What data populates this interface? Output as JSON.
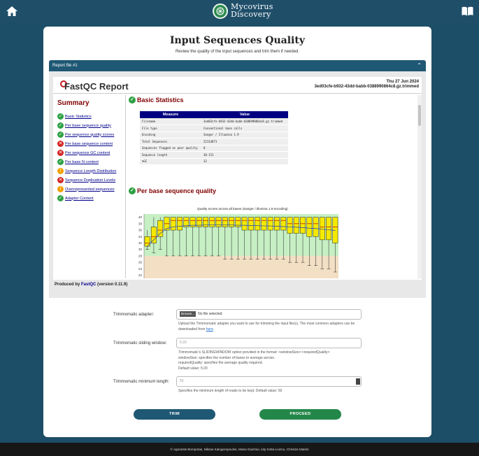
{
  "app": {
    "name_line1": "Mycovirus",
    "name_line2": "Discovery"
  },
  "page": {
    "title": "Input Sequences Quality",
    "subtitle": "Review the quality of the input sequences and trim them if needed."
  },
  "report": {
    "header": "Report file #1",
    "fastqc_title": "FastQC Report",
    "date": "Thu 27 Jun 2024",
    "file_id": "3ed03cfe-b932-43dd-babb-0388990864c8.gz.trimmed",
    "summary_heading": "Summary",
    "modules": [
      {
        "label": "Basic Statistics",
        "status": "pass"
      },
      {
        "label": "Per base sequence quality",
        "status": "pass"
      },
      {
        "label": "Per sequence quality scores",
        "status": "pass"
      },
      {
        "label": "Per base sequence content",
        "status": "fail"
      },
      {
        "label": "Per sequence GC content",
        "status": "fail"
      },
      {
        "label": "Per base N content",
        "status": "pass"
      },
      {
        "label": "Sequence Length Distribution",
        "status": "warn"
      },
      {
        "label": "Sequence Duplication Levels",
        "status": "fail"
      },
      {
        "label": "Overrepresented sequences",
        "status": "warn"
      },
      {
        "label": "Adapter Content",
        "status": "pass"
      }
    ],
    "basic_stats": {
      "heading": "Basic Statistics",
      "col_measure": "Measure",
      "col_value": "Value",
      "rows": [
        {
          "measure": "Filename",
          "value": "3ed03cfe-b932-43dd-babb-0388990864c8.gz.trimmed"
        },
        {
          "measure": "File type",
          "value": "Conventional base calls"
        },
        {
          "measure": "Encoding",
          "value": "Sanger / Illumina 1.9"
        },
        {
          "measure": "Total Sequences",
          "value": "22114871"
        },
        {
          "measure": "Sequences flagged as poor quality",
          "value": "0"
        },
        {
          "measure": "Sequence length",
          "value": "30-151"
        },
        {
          "measure": "%GC",
          "value": "32"
        }
      ]
    },
    "quality_section": {
      "heading": "Per base sequence quality",
      "caption": "Quality scores across all bases (Sanger / Illumina 1.9 encoding)"
    },
    "produced_prefix": "Produced by",
    "produced_link": "FastQC",
    "produced_suffix": "(version 0.11.9)"
  },
  "chart_data": {
    "type": "box",
    "title": "Quality scores across all bases (Sanger / Illumina 1.9 encoding)",
    "y_ticks": [
      40,
      38,
      36,
      34,
      32,
      30,
      28,
      26,
      24,
      22,
      20,
      18
    ],
    "ylim": [
      18,
      41
    ],
    "zones": [
      {
        "from": 28,
        "to": 41,
        "color": "#c6efc3"
      },
      {
        "from": 20,
        "to": 28,
        "color": "#f3dfc4"
      },
      {
        "from": 18,
        "to": 20,
        "color": "#f2c5c5"
      }
    ],
    "boxes": [
      {
        "low": 30,
        "q1": 31,
        "median": 32,
        "q3": 34,
        "high": 36
      },
      {
        "low": 29,
        "q1": 32,
        "median": 34,
        "q3": 37,
        "high": 40
      },
      {
        "low": 30,
        "q1": 34,
        "median": 36,
        "q3": 39,
        "high": 40
      },
      {
        "low": 28,
        "q1": 36,
        "median": 38,
        "q3": 40,
        "high": 40
      },
      {
        "low": 28,
        "q1": 36,
        "median": 39,
        "q3": 40,
        "high": 40
      },
      {
        "low": 28,
        "q1": 36,
        "median": 39,
        "q3": 40,
        "high": 40
      },
      {
        "low": 28,
        "q1": 37,
        "median": 39,
        "q3": 40,
        "high": 40
      },
      {
        "low": 28,
        "q1": 37,
        "median": 39,
        "q3": 40,
        "high": 40
      },
      {
        "low": 28,
        "q1": 37,
        "median": 39,
        "q3": 40,
        "high": 40
      },
      {
        "low": 28,
        "q1": 37,
        "median": 39,
        "q3": 40,
        "high": 40
      },
      {
        "low": 28,
        "q1": 37,
        "median": 39,
        "q3": 40,
        "high": 40
      },
      {
        "low": 28,
        "q1": 37,
        "median": 39,
        "q3": 40,
        "high": 40
      },
      {
        "low": 27,
        "q1": 37,
        "median": 39,
        "q3": 40,
        "high": 40
      },
      {
        "low": 27,
        "q1": 37,
        "median": 39,
        "q3": 40,
        "high": 40
      },
      {
        "low": 27,
        "q1": 37,
        "median": 39,
        "q3": 40,
        "high": 40
      },
      {
        "low": 27,
        "q1": 36,
        "median": 39,
        "q3": 40,
        "high": 40
      },
      {
        "low": 27,
        "q1": 36,
        "median": 39,
        "q3": 40,
        "high": 40
      },
      {
        "low": 27,
        "q1": 36,
        "median": 39,
        "q3": 40,
        "high": 40
      },
      {
        "low": 27,
        "q1": 36,
        "median": 39,
        "q3": 40,
        "high": 40
      },
      {
        "low": 27,
        "q1": 36,
        "median": 39,
        "q3": 40,
        "high": 40
      },
      {
        "low": 27,
        "q1": 36,
        "median": 39,
        "q3": 40,
        "high": 40
      },
      {
        "low": 27,
        "q1": 36,
        "median": 39,
        "q3": 40,
        "high": 40
      },
      {
        "low": 26,
        "q1": 35,
        "median": 38,
        "q3": 40,
        "high": 40
      },
      {
        "low": 26,
        "q1": 35,
        "median": 38,
        "q3": 40,
        "high": 40
      },
      {
        "low": 26,
        "q1": 35,
        "median": 38,
        "q3": 40,
        "high": 40
      },
      {
        "low": 25,
        "q1": 34,
        "median": 38,
        "q3": 40,
        "high": 40
      },
      {
        "low": 25,
        "q1": 34,
        "median": 38,
        "q3": 40,
        "high": 40
      },
      {
        "low": 24,
        "q1": 33,
        "median": 37,
        "q3": 40,
        "high": 40
      },
      {
        "low": 24,
        "q1": 33,
        "median": 37,
        "q3": 40,
        "high": 40
      },
      {
        "low": 23,
        "q1": 32,
        "median": 37,
        "q3": 40,
        "high": 40
      }
    ],
    "mean_line": [
      31,
      33,
      35,
      36.5,
      37,
      37.2,
      37.4,
      37.5,
      37.5,
      37.6,
      37.6,
      37.6,
      37.6,
      37.6,
      37.5,
      37.5,
      37.4,
      37.4,
      37.3,
      37.3,
      37.2,
      37.1,
      37,
      36.9,
      36.8,
      36.6,
      36.5,
      36.3,
      36.1,
      35.9
    ]
  },
  "form": {
    "adapter_label": "Trimmomatic adapter:",
    "browse_label": "Browse...",
    "no_file": "No file selected.",
    "adapter_help": "Upload the Trimmomatic adapter you want to use for trimming the input file(s). The most common adapters can be downloaded from",
    "adapter_help_link": "here",
    "window_label": "Trimmomatic sliding window:",
    "window_placeholder": "5:20",
    "window_help_1": "Trimmomatic's SLIDINGWINDOW option provided in the format: <windowSize>:<requiredQuality>",
    "window_help_2": "windowSize: specifies the number of bases to average across.",
    "window_help_3": "requiredQuality: specifies the average quality required.",
    "window_help_4": "Default value: 5:20",
    "minlen_label": "Trimmomatic minimum length:",
    "minlen_placeholder": "50",
    "minlen_help": "Specifies the minimum length of reads to be kept. Default value: 50"
  },
  "buttons": {
    "trim": "TRIM",
    "proceed": "PROCEED"
  },
  "footer": {
    "text": "© Agorastis Bompotas, Nikitas Kalogeropoulos, Maria Giachiui, Ioly Kotta-Loizou, Christos Makris"
  }
}
